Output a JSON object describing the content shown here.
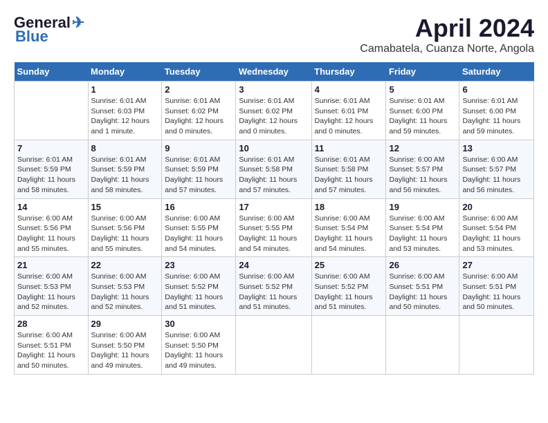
{
  "header": {
    "logo_general": "General",
    "logo_blue": "Blue",
    "month_title": "April 2024",
    "location": "Camabatela, Cuanza Norte, Angola"
  },
  "weekdays": [
    "Sunday",
    "Monday",
    "Tuesday",
    "Wednesday",
    "Thursday",
    "Friday",
    "Saturday"
  ],
  "weeks": [
    [
      {
        "day": "",
        "info": ""
      },
      {
        "day": "1",
        "info": "Sunrise: 6:01 AM\nSunset: 6:03 PM\nDaylight: 12 hours\nand 1 minute."
      },
      {
        "day": "2",
        "info": "Sunrise: 6:01 AM\nSunset: 6:02 PM\nDaylight: 12 hours\nand 0 minutes."
      },
      {
        "day": "3",
        "info": "Sunrise: 6:01 AM\nSunset: 6:02 PM\nDaylight: 12 hours\nand 0 minutes."
      },
      {
        "day": "4",
        "info": "Sunrise: 6:01 AM\nSunset: 6:01 PM\nDaylight: 12 hours\nand 0 minutes."
      },
      {
        "day": "5",
        "info": "Sunrise: 6:01 AM\nSunset: 6:00 PM\nDaylight: 11 hours\nand 59 minutes."
      },
      {
        "day": "6",
        "info": "Sunrise: 6:01 AM\nSunset: 6:00 PM\nDaylight: 11 hours\nand 59 minutes."
      }
    ],
    [
      {
        "day": "7",
        "info": "Sunrise: 6:01 AM\nSunset: 5:59 PM\nDaylight: 11 hours\nand 58 minutes."
      },
      {
        "day": "8",
        "info": "Sunrise: 6:01 AM\nSunset: 5:59 PM\nDaylight: 11 hours\nand 58 minutes."
      },
      {
        "day": "9",
        "info": "Sunrise: 6:01 AM\nSunset: 5:59 PM\nDaylight: 11 hours\nand 57 minutes."
      },
      {
        "day": "10",
        "info": "Sunrise: 6:01 AM\nSunset: 5:58 PM\nDaylight: 11 hours\nand 57 minutes."
      },
      {
        "day": "11",
        "info": "Sunrise: 6:01 AM\nSunset: 5:58 PM\nDaylight: 11 hours\nand 57 minutes."
      },
      {
        "day": "12",
        "info": "Sunrise: 6:00 AM\nSunset: 5:57 PM\nDaylight: 11 hours\nand 56 minutes."
      },
      {
        "day": "13",
        "info": "Sunrise: 6:00 AM\nSunset: 5:57 PM\nDaylight: 11 hours\nand 56 minutes."
      }
    ],
    [
      {
        "day": "14",
        "info": "Sunrise: 6:00 AM\nSunset: 5:56 PM\nDaylight: 11 hours\nand 55 minutes."
      },
      {
        "day": "15",
        "info": "Sunrise: 6:00 AM\nSunset: 5:56 PM\nDaylight: 11 hours\nand 55 minutes."
      },
      {
        "day": "16",
        "info": "Sunrise: 6:00 AM\nSunset: 5:55 PM\nDaylight: 11 hours\nand 54 minutes."
      },
      {
        "day": "17",
        "info": "Sunrise: 6:00 AM\nSunset: 5:55 PM\nDaylight: 11 hours\nand 54 minutes."
      },
      {
        "day": "18",
        "info": "Sunrise: 6:00 AM\nSunset: 5:54 PM\nDaylight: 11 hours\nand 54 minutes."
      },
      {
        "day": "19",
        "info": "Sunrise: 6:00 AM\nSunset: 5:54 PM\nDaylight: 11 hours\nand 53 minutes."
      },
      {
        "day": "20",
        "info": "Sunrise: 6:00 AM\nSunset: 5:54 PM\nDaylight: 11 hours\nand 53 minutes."
      }
    ],
    [
      {
        "day": "21",
        "info": "Sunrise: 6:00 AM\nSunset: 5:53 PM\nDaylight: 11 hours\nand 52 minutes."
      },
      {
        "day": "22",
        "info": "Sunrise: 6:00 AM\nSunset: 5:53 PM\nDaylight: 11 hours\nand 52 minutes."
      },
      {
        "day": "23",
        "info": "Sunrise: 6:00 AM\nSunset: 5:52 PM\nDaylight: 11 hours\nand 51 minutes."
      },
      {
        "day": "24",
        "info": "Sunrise: 6:00 AM\nSunset: 5:52 PM\nDaylight: 11 hours\nand 51 minutes."
      },
      {
        "day": "25",
        "info": "Sunrise: 6:00 AM\nSunset: 5:52 PM\nDaylight: 11 hours\nand 51 minutes."
      },
      {
        "day": "26",
        "info": "Sunrise: 6:00 AM\nSunset: 5:51 PM\nDaylight: 11 hours\nand 50 minutes."
      },
      {
        "day": "27",
        "info": "Sunrise: 6:00 AM\nSunset: 5:51 PM\nDaylight: 11 hours\nand 50 minutes."
      }
    ],
    [
      {
        "day": "28",
        "info": "Sunrise: 6:00 AM\nSunset: 5:51 PM\nDaylight: 11 hours\nand 50 minutes."
      },
      {
        "day": "29",
        "info": "Sunrise: 6:00 AM\nSunset: 5:50 PM\nDaylight: 11 hours\nand 49 minutes."
      },
      {
        "day": "30",
        "info": "Sunrise: 6:00 AM\nSunset: 5:50 PM\nDaylight: 11 hours\nand 49 minutes."
      },
      {
        "day": "",
        "info": ""
      },
      {
        "day": "",
        "info": ""
      },
      {
        "day": "",
        "info": ""
      },
      {
        "day": "",
        "info": ""
      }
    ]
  ]
}
